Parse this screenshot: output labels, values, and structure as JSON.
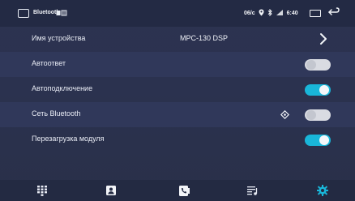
{
  "status_bar": {
    "app_title": "Bluetooth",
    "channel": "06/c",
    "clock": "6:40",
    "icons": [
      "home-outline-icon",
      "bluetooth-badge-icon",
      "gps-icon",
      "bluetooth-icon",
      "signal-icon",
      "screen-icon",
      "back-icon"
    ]
  },
  "settings": {
    "device_name": {
      "label": "Имя устройства",
      "value": "MPC-130 DSP"
    },
    "auto_answer": {
      "label": "Автоответ",
      "enabled": false
    },
    "auto_connect": {
      "label": "Автоподключение",
      "enabled": true
    },
    "bt_network": {
      "label": "Сеть Bluetooth",
      "enabled": false
    },
    "module_reboot": {
      "label": "Перезагрузка модуля",
      "enabled": true
    }
  },
  "bottom_nav": {
    "items": [
      {
        "icon": "dialpad-icon",
        "active": false
      },
      {
        "icon": "contacts-icon",
        "active": false
      },
      {
        "icon": "call-log-icon",
        "active": false
      },
      {
        "icon": "music-icon",
        "active": false
      },
      {
        "icon": "settings-gear-icon",
        "active": true
      }
    ]
  },
  "colors": {
    "accent": "#19b6d9",
    "background": "#2b324f",
    "toggle_off": "#d9dbe2"
  }
}
